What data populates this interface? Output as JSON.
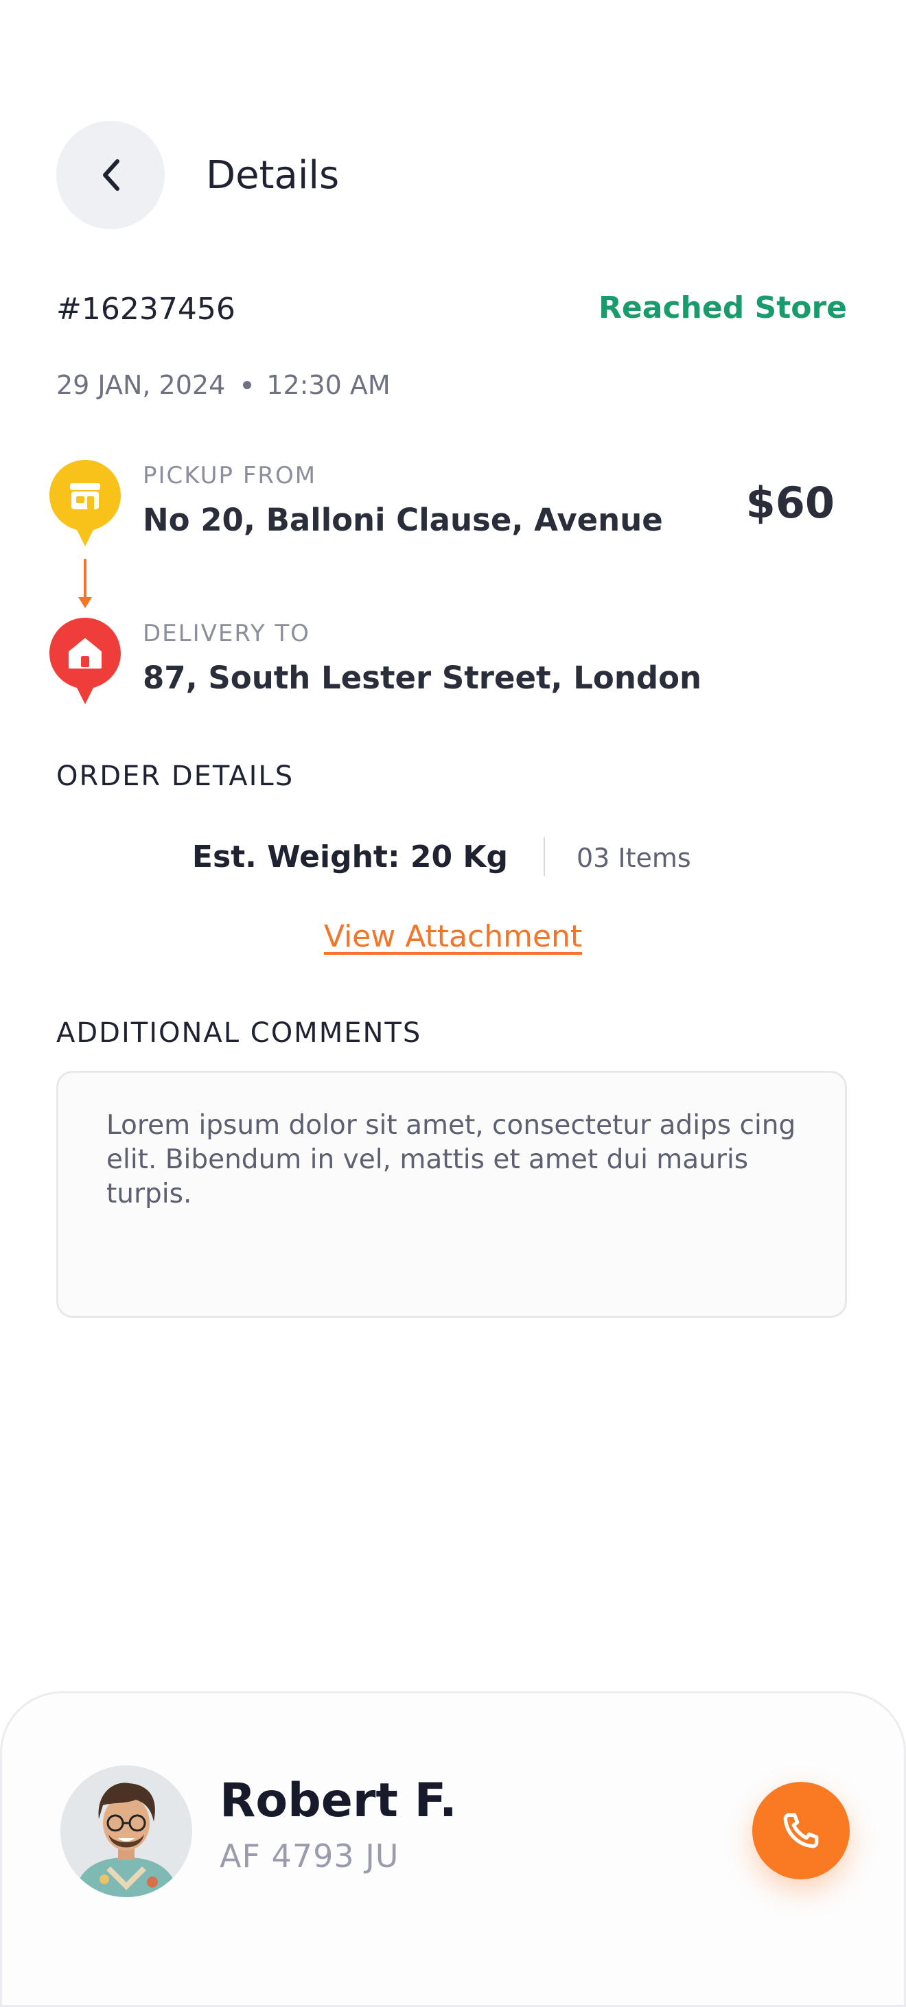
{
  "header": {
    "title": "Details",
    "back_icon": "chevron-left-icon"
  },
  "order": {
    "id": "#16237456",
    "status": "Reached Store",
    "status_color": "#1a9b6c",
    "date": "29 JAN, 2024",
    "time": "12:30 AM",
    "price": "$60"
  },
  "pickup": {
    "label": "PICKUP FROM",
    "address": "No 20, Balloni Clause, Avenue",
    "icon": "store-pin-icon",
    "color": "#f8c21b"
  },
  "delivery": {
    "label": "DELIVERY TO",
    "address": "87, South Lester Street, London",
    "icon": "home-pin-icon",
    "color": "#ef3e3a"
  },
  "order_details": {
    "heading": "ORDER DETAILS",
    "weight": "Est. Weight: 20 Kg",
    "items": "03 Items",
    "attachment_link": "View Attachment"
  },
  "comments": {
    "heading": "ADDITIONAL COMMENTS",
    "text": "Lorem ipsum dolor sit amet, consectetur adips cing elit. Bibendum in vel, mattis et amet dui mauris turpis."
  },
  "driver": {
    "name": "Robert F.",
    "plate": "AF 4793 JU",
    "call_icon": "phone-icon",
    "accent_color": "#fa7923"
  }
}
